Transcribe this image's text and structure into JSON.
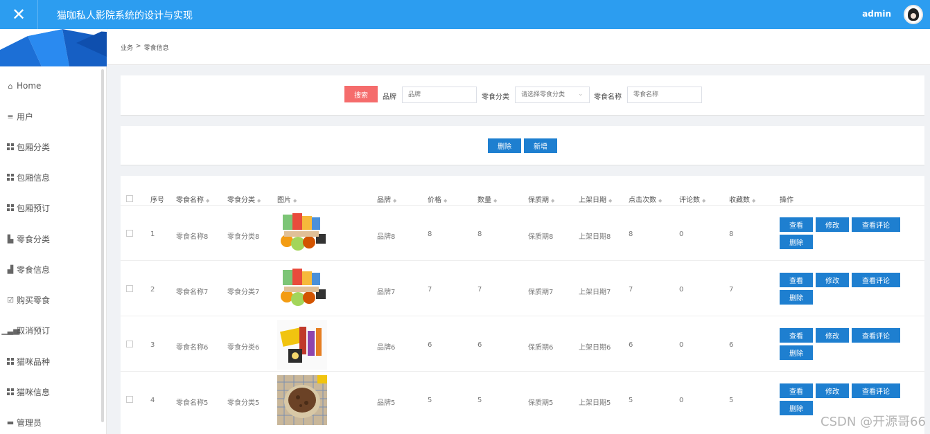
{
  "app": {
    "title": "猫咖私人影院系统的设计与实现",
    "user": "admin"
  },
  "sidebar": {
    "items": [
      {
        "label": "Home",
        "icon": "home-icon"
      },
      {
        "label": "用户",
        "icon": "list-icon"
      },
      {
        "label": "包厢分类",
        "icon": "grid-icon"
      },
      {
        "label": "包厢信息",
        "icon": "grid-icon"
      },
      {
        "label": "包厢预订",
        "icon": "grid-icon"
      },
      {
        "label": "零食分类",
        "icon": "bar-chart-icon"
      },
      {
        "label": "零食信息",
        "icon": "cart-icon"
      },
      {
        "label": "购买零食",
        "icon": "check-icon"
      },
      {
        "label": "取消预订",
        "icon": "chart-icon"
      },
      {
        "label": "猫咪品种",
        "icon": "grid-icon"
      },
      {
        "label": "猫咪信息",
        "icon": "grid-icon"
      },
      {
        "label": "管理员",
        "icon": "monitor-icon"
      }
    ]
  },
  "breadcrumb": {
    "first": "业务",
    "separator": ">",
    "current": "零食信息"
  },
  "search": {
    "button": "搜索",
    "brand_label": "品牌",
    "brand_placeholder": "品牌",
    "category_label": "零食分类",
    "category_placeholder": "请选择零食分类",
    "name_label": "零食名称",
    "name_placeholder": "零食名称"
  },
  "actions": {
    "delete": "删除",
    "add": "新增"
  },
  "table": {
    "headers": [
      "序号",
      "零食名称",
      "零食分类",
      "图片",
      "品牌",
      "价格",
      "数量",
      "保质期",
      "上架日期",
      "点击次数",
      "评论数",
      "收藏数",
      "操作"
    ],
    "rows": [
      {
        "index": "1",
        "name": "零食名称8",
        "category": "零食分类8",
        "image": "snack-box-image",
        "brand": "品牌8",
        "price": "8",
        "quantity": "8",
        "shelf_life": "保质期8",
        "date": "上架日期8",
        "clicks": "8",
        "comments": "0",
        "favorites": "8"
      },
      {
        "index": "2",
        "name": "零食名称7",
        "category": "零食分类7",
        "image": "snack-box-image",
        "brand": "品牌7",
        "price": "7",
        "quantity": "7",
        "shelf_life": "保质期7",
        "date": "上架日期7",
        "clicks": "7",
        "comments": "0",
        "favorites": "7"
      },
      {
        "index": "3",
        "name": "零食名称6",
        "category": "零食分类6",
        "image": "imported-snacks-image",
        "brand": "品牌6",
        "price": "6",
        "quantity": "6",
        "shelf_life": "保质期6",
        "date": "上架日期6",
        "clicks": "6",
        "comments": "0",
        "favorites": "6"
      },
      {
        "index": "4",
        "name": "零食名称5",
        "category": "零食分类5",
        "image": "cookies-image",
        "brand": "品牌5",
        "price": "5",
        "quantity": "5",
        "shelf_life": "保质期5",
        "date": "上架日期5",
        "clicks": "5",
        "comments": "0",
        "favorites": "5"
      }
    ],
    "row_actions": {
      "view": "查看",
      "edit": "修改",
      "view_comments": "查看评论",
      "delete": "删除"
    }
  },
  "watermark": "CSDN @开源哥66",
  "colors": {
    "header": "#2c9df0",
    "primary_button": "#1e7fd0",
    "search_button": "#f56c6c"
  }
}
